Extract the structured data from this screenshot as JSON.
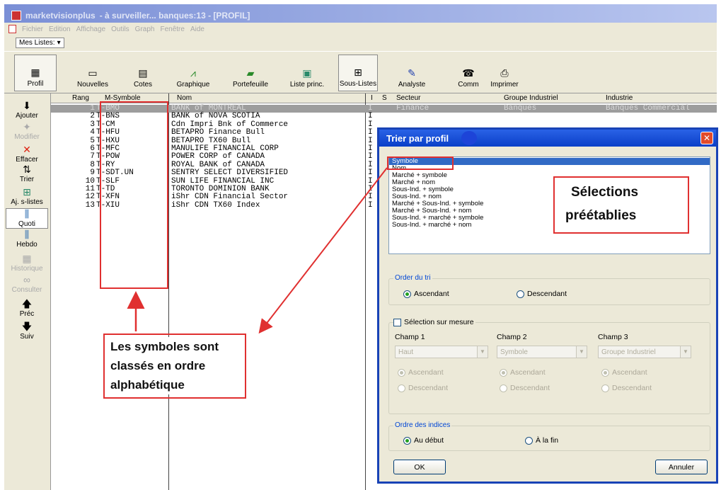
{
  "window": {
    "title_app": "marketvisionplus",
    "title_rest": "- à surveiller... banques:13 - [PROFIL]"
  },
  "menu": [
    "Fichier",
    "Edition",
    "Affichage",
    "Outils",
    "Graph",
    "Fenêtre",
    "Aide"
  ],
  "lists_dropdown": {
    "label": "Mes Listes:",
    "arrow": "▾"
  },
  "toolbar": {
    "profil": "Profil",
    "nouvelles": "Nouvelles",
    "cotes": "Cotes",
    "graphique": "Graphique",
    "portefeuille": "Portefeuille",
    "liste_princ": "Liste princ.",
    "sous_listes": "Sous-Listes",
    "analyste": "Analyste",
    "comm": "Comm",
    "imprimer": "Imprimer"
  },
  "sidebar": {
    "ajouter": "Ajouter",
    "modifier": "Modifier",
    "effacer": "Effacer",
    "trier": "Trier",
    "aj_slistes": "Aj. s-listes",
    "quoti": "Quoti",
    "hebdo": "Hebdo",
    "historique": "Historique",
    "consulter": "Consulter",
    "prec": "Préc",
    "suiv": "Suiv"
  },
  "grid": {
    "headers": {
      "rang": "Rang",
      "msymbole": "M-Symbole",
      "nom": "Nom",
      "i": "I",
      "s": "S",
      "secteur": "Secteur",
      "groupe": "Groupe Industriel",
      "industrie": "Industrie"
    },
    "first_row_extra": {
      "secteur": "Finance",
      "groupe": "Banques",
      "industrie": "Banques Commercial"
    },
    "rows": [
      {
        "rang": "1",
        "symbole": "T-BMO",
        "nom": "BANK of MONTREAL",
        "i": "I"
      },
      {
        "rang": "2",
        "symbole": "T-BNS",
        "nom": "BANK of NOVA SCOTIA",
        "i": "I"
      },
      {
        "rang": "3",
        "symbole": "T-CM",
        "nom": "Cdn Impri Bnk of Commerce",
        "i": "I"
      },
      {
        "rang": "4",
        "symbole": "T-HFU",
        "nom": "BETAPRO Finance Bull",
        "i": "I"
      },
      {
        "rang": "5",
        "symbole": "T-HXU",
        "nom": "BETAPRO TX60 Bull",
        "i": "I"
      },
      {
        "rang": "6",
        "symbole": "T-MFC",
        "nom": "MANULIFE FINANCIAL CORP",
        "i": "I"
      },
      {
        "rang": "7",
        "symbole": "T-POW",
        "nom": "POWER CORP of CANADA",
        "i": "I"
      },
      {
        "rang": "8",
        "symbole": "T-RY",
        "nom": "ROYAL BANK of CANADA",
        "i": "I"
      },
      {
        "rang": "9",
        "symbole": "T-SDT.UN",
        "nom": "SENTRY SELECT DIVERSIFIED",
        "i": "I"
      },
      {
        "rang": "10",
        "symbole": "T-SLF",
        "nom": "SUN LIFE FINANCIAL INC",
        "i": "I"
      },
      {
        "rang": "11",
        "symbole": "T-TD",
        "nom": "TORONTO DOMINION BANK",
        "i": "I"
      },
      {
        "rang": "12",
        "symbole": "T-XFN",
        "nom": "iShr CDN Financial Sector",
        "i": "I"
      },
      {
        "rang": "13",
        "symbole": "T-XIU",
        "nom": "iShr CDN TX60 Index",
        "i": "I"
      }
    ]
  },
  "dialog": {
    "title": "Trier par profil",
    "close": "✕",
    "profiles": [
      "Symbole",
      "Nom",
      "Marché + symbole",
      "Marché + nom",
      "Sous-Ind. + symbole",
      "Sous-Ind. + nom",
      "Marché + Sous-Ind. + symbole",
      "Marché + Sous-Ind. + nom",
      "Sous-Ind. + marché + symbole",
      "Sous-Ind. + marché + nom"
    ],
    "order_group": "Order du tri",
    "ascendant": "Ascendant",
    "descendant": "Descendant",
    "custom_check": "Sélection sur mesure",
    "champ1": "Champ 1",
    "champ2": "Champ 2",
    "champ3": "Champ 3",
    "champ1_val": "Haut",
    "champ2_val": "Symbole",
    "champ3_val": "Groupe Industriel",
    "indices_group": "Ordre des indices",
    "au_debut": "Au début",
    "a_la_fin": "À la fin",
    "ok": "OK",
    "annuler": "Annuler"
  },
  "annotations": {
    "selections_line1": "Sélections",
    "selections_line2": "préétablies",
    "symbols_line1": "Les symboles sont",
    "symbols_line2": "classés en ordre",
    "symbols_line3": "alphabétique"
  },
  "colors": {
    "annotation_red": "#e03030",
    "dialog_blue": "#1943b6",
    "selected_blue": "#316ac5"
  }
}
